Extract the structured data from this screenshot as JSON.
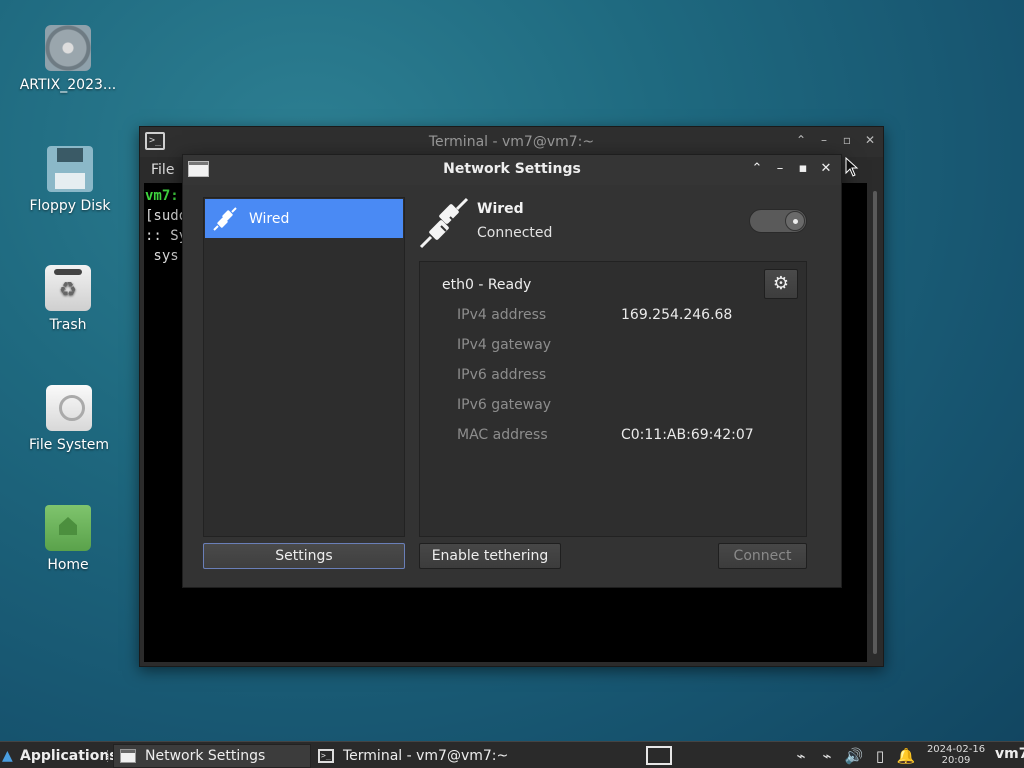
{
  "desktop": {
    "icons": [
      {
        "label": "ARTIX_2023..."
      },
      {
        "label": "Floppy Disk"
      },
      {
        "label": "Trash"
      },
      {
        "label": "File System"
      },
      {
        "label": "Home"
      }
    ]
  },
  "terminal": {
    "title": "Terminal - vm7@vm7:~",
    "menu_file": "File",
    "lines": [
      "vm7:",
      "[sudo",
      ":: Sy",
      " sys"
    ]
  },
  "network": {
    "title": "Network Settings",
    "list_item": "Wired",
    "header_name": "Wired",
    "header_status": "Connected",
    "iface_title": "eth0 - Ready",
    "rows": [
      {
        "key": "IPv4 address",
        "value": "169.254.246.68"
      },
      {
        "key": "IPv4 gateway",
        "value": ""
      },
      {
        "key": "IPv6 address",
        "value": ""
      },
      {
        "key": "IPv6 gateway",
        "value": ""
      },
      {
        "key": "MAC address",
        "value": "C0:11:AB:69:42:07"
      }
    ],
    "buttons": {
      "settings": "Settings",
      "tethering": "Enable tethering",
      "connect": "Connect"
    },
    "toggle_on": false
  },
  "taskbar": {
    "applications": "Applications",
    "tasks": [
      "Network Settings",
      "Terminal - vm7@vm7:~"
    ],
    "clock_date": "2024-02-16",
    "clock_time": "20:09",
    "user": "vm7"
  },
  "colors": {
    "accent": "#4a8af4",
    "prompt": "#3fd43f"
  }
}
